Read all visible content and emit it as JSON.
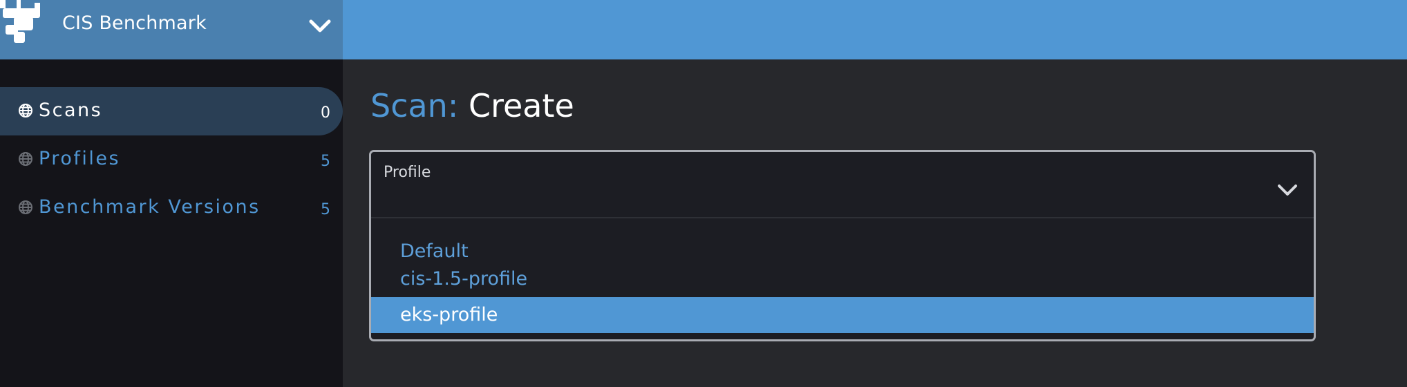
{
  "header": {
    "cluster_name": "CIS Benchmark",
    "logo_icon": "rancher-cow-logo-icon",
    "chevron_icon": "chevron-down-icon",
    "accent_color": "#5097d4"
  },
  "sidebar": {
    "items": [
      {
        "label": "Scans",
        "count": "0",
        "icon": "globe-icon",
        "active": true
      },
      {
        "label": "Profiles",
        "count": "5",
        "icon": "globe-icon",
        "active": false
      },
      {
        "label": "Benchmark Versions",
        "count": "5",
        "icon": "globe-icon",
        "active": false
      }
    ]
  },
  "main": {
    "title_prefix": "Scan:",
    "title_main": "Create",
    "profile_select": {
      "label": "Profile",
      "chevron_icon": "chevron-down-icon",
      "options": [
        "Default",
        "cis-1.5-profile",
        "eks-profile"
      ],
      "highlighted": "eks-profile"
    }
  }
}
